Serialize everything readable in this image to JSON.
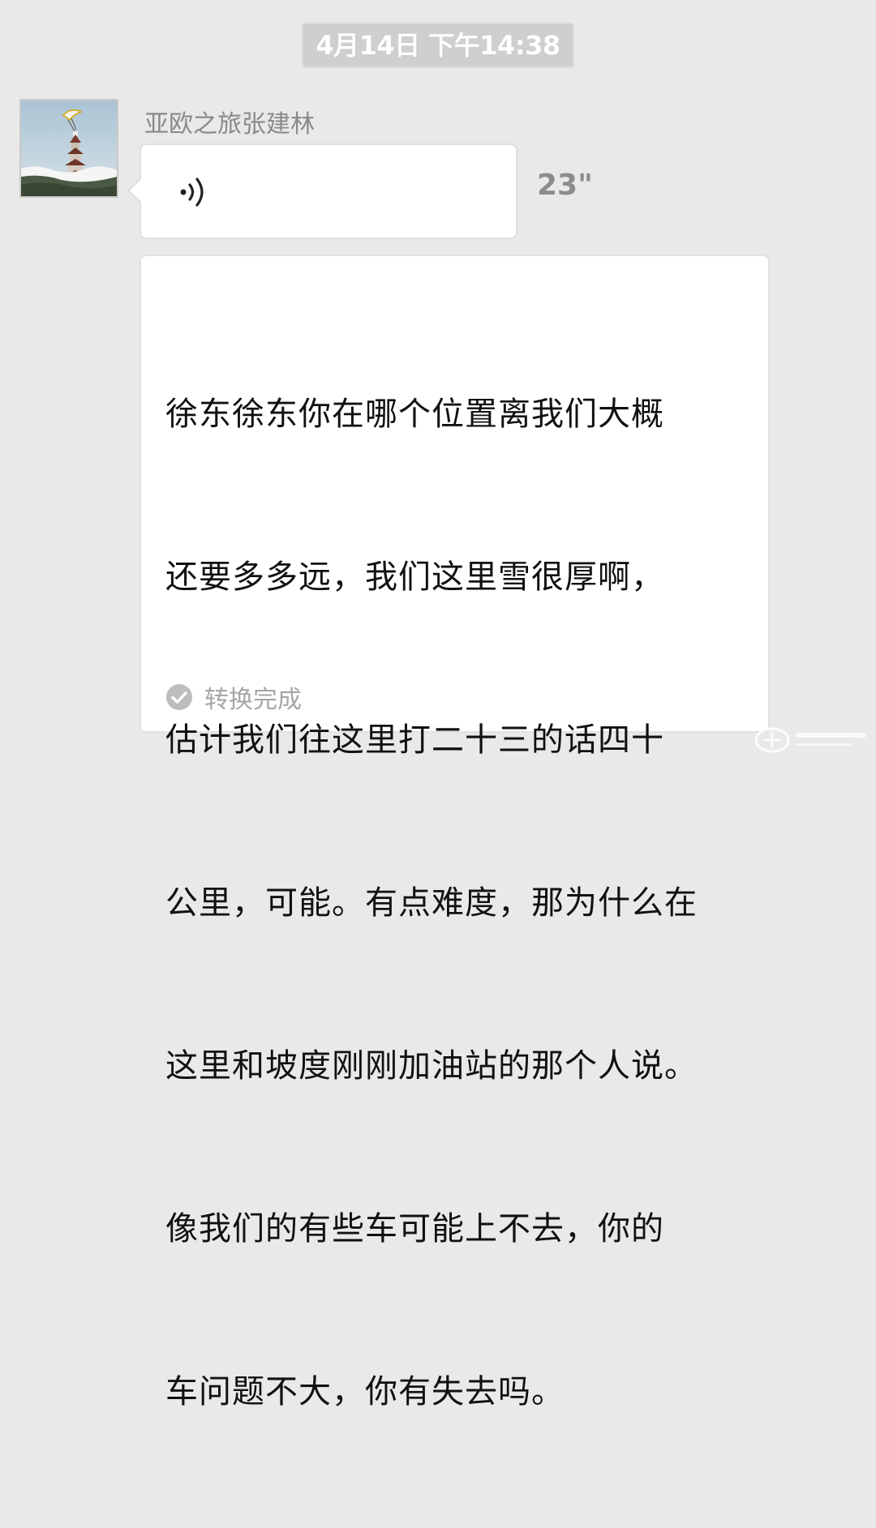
{
  "chat": {
    "timestamp": "4月14日 下午14:38",
    "sender": {
      "name": "亚欧之旅张建林",
      "avatar_icon": "pagoda-avatar-icon"
    },
    "voice_message": {
      "icon": "voice-wave-icon",
      "duration": "23\""
    },
    "transcript": {
      "lines": [
        "徐东徐东你在哪个位置离我们大概",
        "还要多多远，我们这里雪很厚啊，",
        "估计我们往这里打二十三的话四十",
        "公里，可能。有点难度，那为什么在",
        "这里和坡度刚刚加油站的那个人说。",
        "像我们的有些车可能上不去，你的",
        "车问题不大，你有失去吗。"
      ],
      "status_icon": "check-circle-icon",
      "status": "转换完成"
    }
  },
  "watermark": {
    "icon": "watermark-logo-icon"
  },
  "colors": {
    "background": "#e9e9e9",
    "bubble": "#ffffff",
    "timestamp_bg": "#cfcfcf",
    "muted_text": "#8a8a8a",
    "text": "#111111"
  }
}
